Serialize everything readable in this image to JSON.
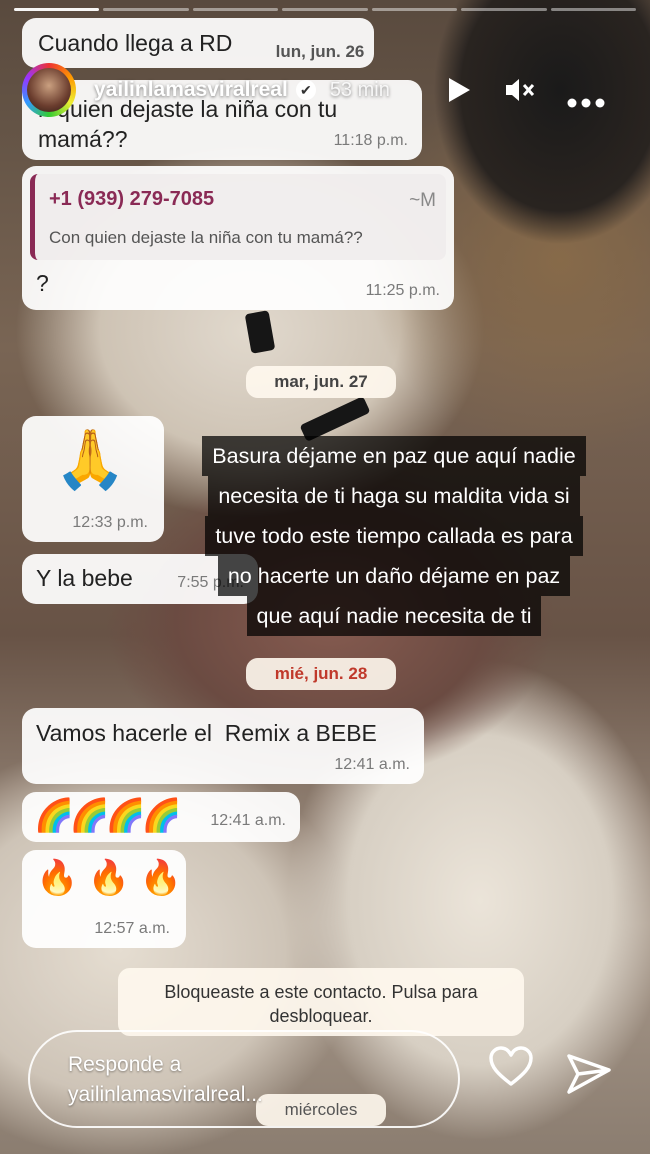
{
  "story": {
    "progress": {
      "segments": 7,
      "active": 1
    },
    "username": "yailinlamasviralreal",
    "verified_glyph": "✔",
    "time_ago": "53 min",
    "play_icon": "play-icon",
    "mute_icon": "speaker-muted-icon",
    "more_icon": "more-dots-icon"
  },
  "chat": {
    "top_partial_text": "Cuando llega a RD",
    "top_partial_date": "lun, jun. 26",
    "msg1": {
      "text": "n quien dejaste la niña con tu mamá??",
      "time": "11:18 p.m."
    },
    "reply": {
      "number": "+1 (939) 279-7085",
      "tilde": "~M",
      "quoted": "Con quien dejaste la niña con tu mamá??",
      "text": "?",
      "time": "11:25 p.m."
    },
    "date_tue": "mar, jun. 27",
    "msg_pray": {
      "emoji": "🙏",
      "time": "12:33 p.m."
    },
    "msg_bebe": {
      "text": "Y la bebe",
      "time": "7:55 p.m."
    },
    "date_wed": "mié, jun. 28",
    "msg_remix": {
      "text": "Vamos hacerle el  Remix a BEBE",
      "time": "12:41 a.m."
    },
    "msg_rainbow": {
      "emoji": "🌈🌈🌈🌈",
      "time": "12:41 a.m."
    },
    "msg_fire": {
      "emoji": "🔥 🔥 🔥",
      "time": "12:57 a.m."
    },
    "blocked_notice": "Bloqueaste a este contacto. Pulsa para desbloquear.",
    "bottom_partial": "miércoles"
  },
  "overlay_caption": [
    "Basura déjame en paz que aquí nadie",
    "necesita de ti haga su maldita vida si",
    "tuve todo este tiempo callada es para",
    "no hacerte un daño déjame en paz",
    "que aquí nadie necesita de ti"
  ],
  "reply_bar": {
    "placeholder": "Responde a yailinlamasviralreal...",
    "heart_icon": "heart-icon",
    "send_icon": "send-icon"
  },
  "colors": {
    "reply_number": "#8a2a55",
    "quote_bar": "#8a2a55",
    "wed_date": "#c0392b"
  }
}
